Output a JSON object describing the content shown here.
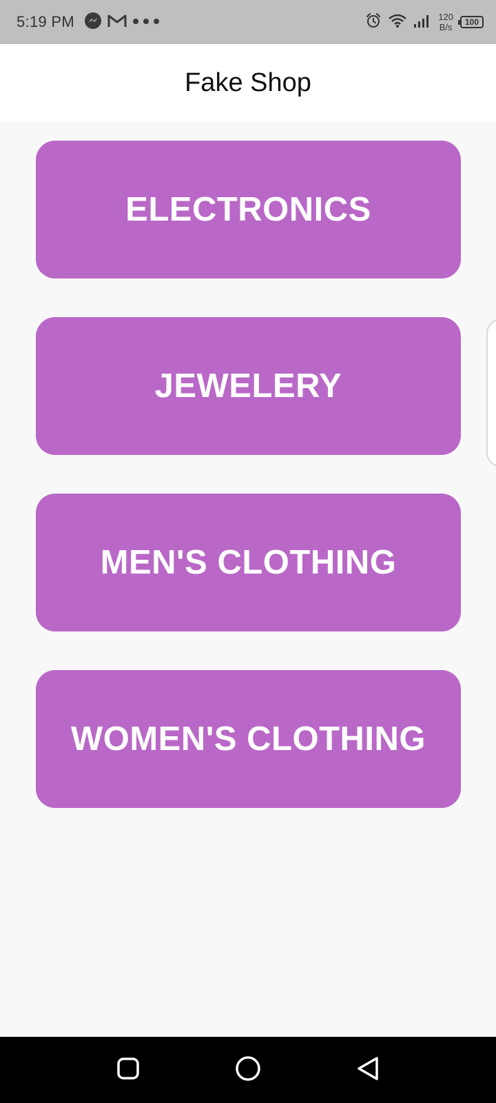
{
  "status_bar": {
    "time": "5:19 PM",
    "net_speed_value": "120",
    "net_speed_unit": "B/s",
    "battery_level": "100",
    "icons": [
      "messenger-icon",
      "gmail-icon",
      "more-dots-icon",
      "alarm-icon",
      "wifi-icon",
      "signal-icon",
      "battery-icon"
    ]
  },
  "app_bar": {
    "title": "Fake Shop"
  },
  "categories": [
    {
      "label": "ELECTRONICS"
    },
    {
      "label": "JEWELERY"
    },
    {
      "label": "MEN'S CLOTHING"
    },
    {
      "label": "WOMEN'S CLOTHING"
    }
  ],
  "colors": {
    "card_background": "#b968c7",
    "card_text": "#ffffff",
    "page_background": "#f8f8f8",
    "status_bar": "#bfbfbf",
    "nav_bar": "#000000"
  },
  "nav_bar": {
    "icons": [
      "recents-square-icon",
      "home-circle-icon",
      "back-triangle-icon"
    ]
  }
}
